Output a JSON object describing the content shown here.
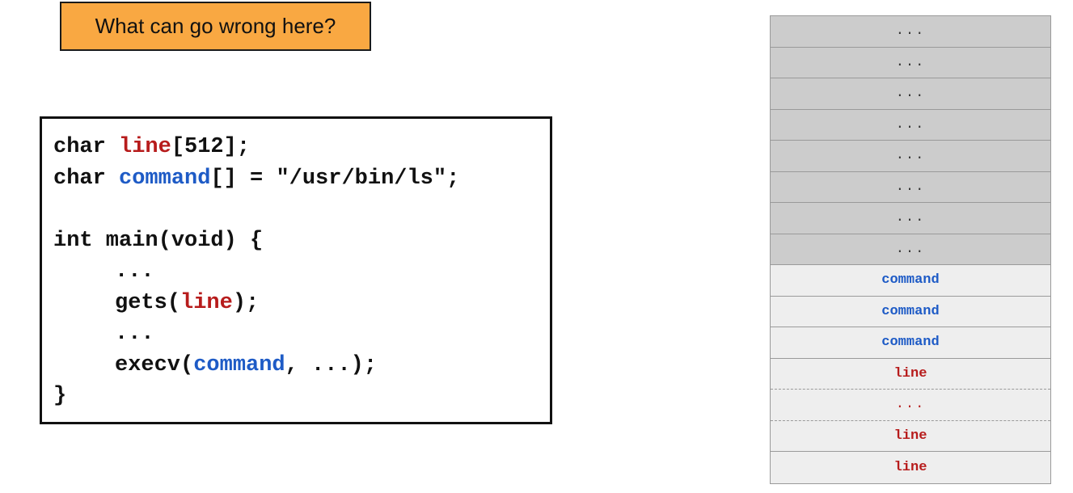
{
  "question": "What can go wrong here?",
  "code": {
    "l1": {
      "kw": "char ",
      "var": "line",
      "rest": "[512];"
    },
    "l2": {
      "kw": "char ",
      "var": "command",
      "rest": "[] = \"/usr/bin/ls\";"
    },
    "l3": "int main(void) {",
    "l4": "...",
    "l5": {
      "pre": "gets(",
      "var": "line",
      "post": ");"
    },
    "l6": "...",
    "l7": {
      "pre": "execv(",
      "var": "command",
      "post": ", ...);"
    },
    "l8": "}"
  },
  "stack": {
    "cells": [
      {
        "label": "...",
        "kind": "unused"
      },
      {
        "label": "...",
        "kind": "unused"
      },
      {
        "label": "...",
        "kind": "unused"
      },
      {
        "label": "...",
        "kind": "unused"
      },
      {
        "label": "...",
        "kind": "unused"
      },
      {
        "label": "...",
        "kind": "unused"
      },
      {
        "label": "...",
        "kind": "unused"
      },
      {
        "label": "...",
        "kind": "unused"
      },
      {
        "label": "command",
        "kind": "command"
      },
      {
        "label": "command",
        "kind": "command"
      },
      {
        "label": "command",
        "kind": "command"
      },
      {
        "label": "line",
        "kind": "line"
      },
      {
        "label": "...",
        "kind": "line"
      },
      {
        "label": "line",
        "kind": "line"
      },
      {
        "label": "line",
        "kind": "line"
      }
    ]
  },
  "colors": {
    "question_bg": "#f9a842",
    "line_var": "#b71c1c",
    "command_var": "#1e5bc6",
    "unused_cell": "#cccccc",
    "used_cell": "#eeeeee"
  }
}
